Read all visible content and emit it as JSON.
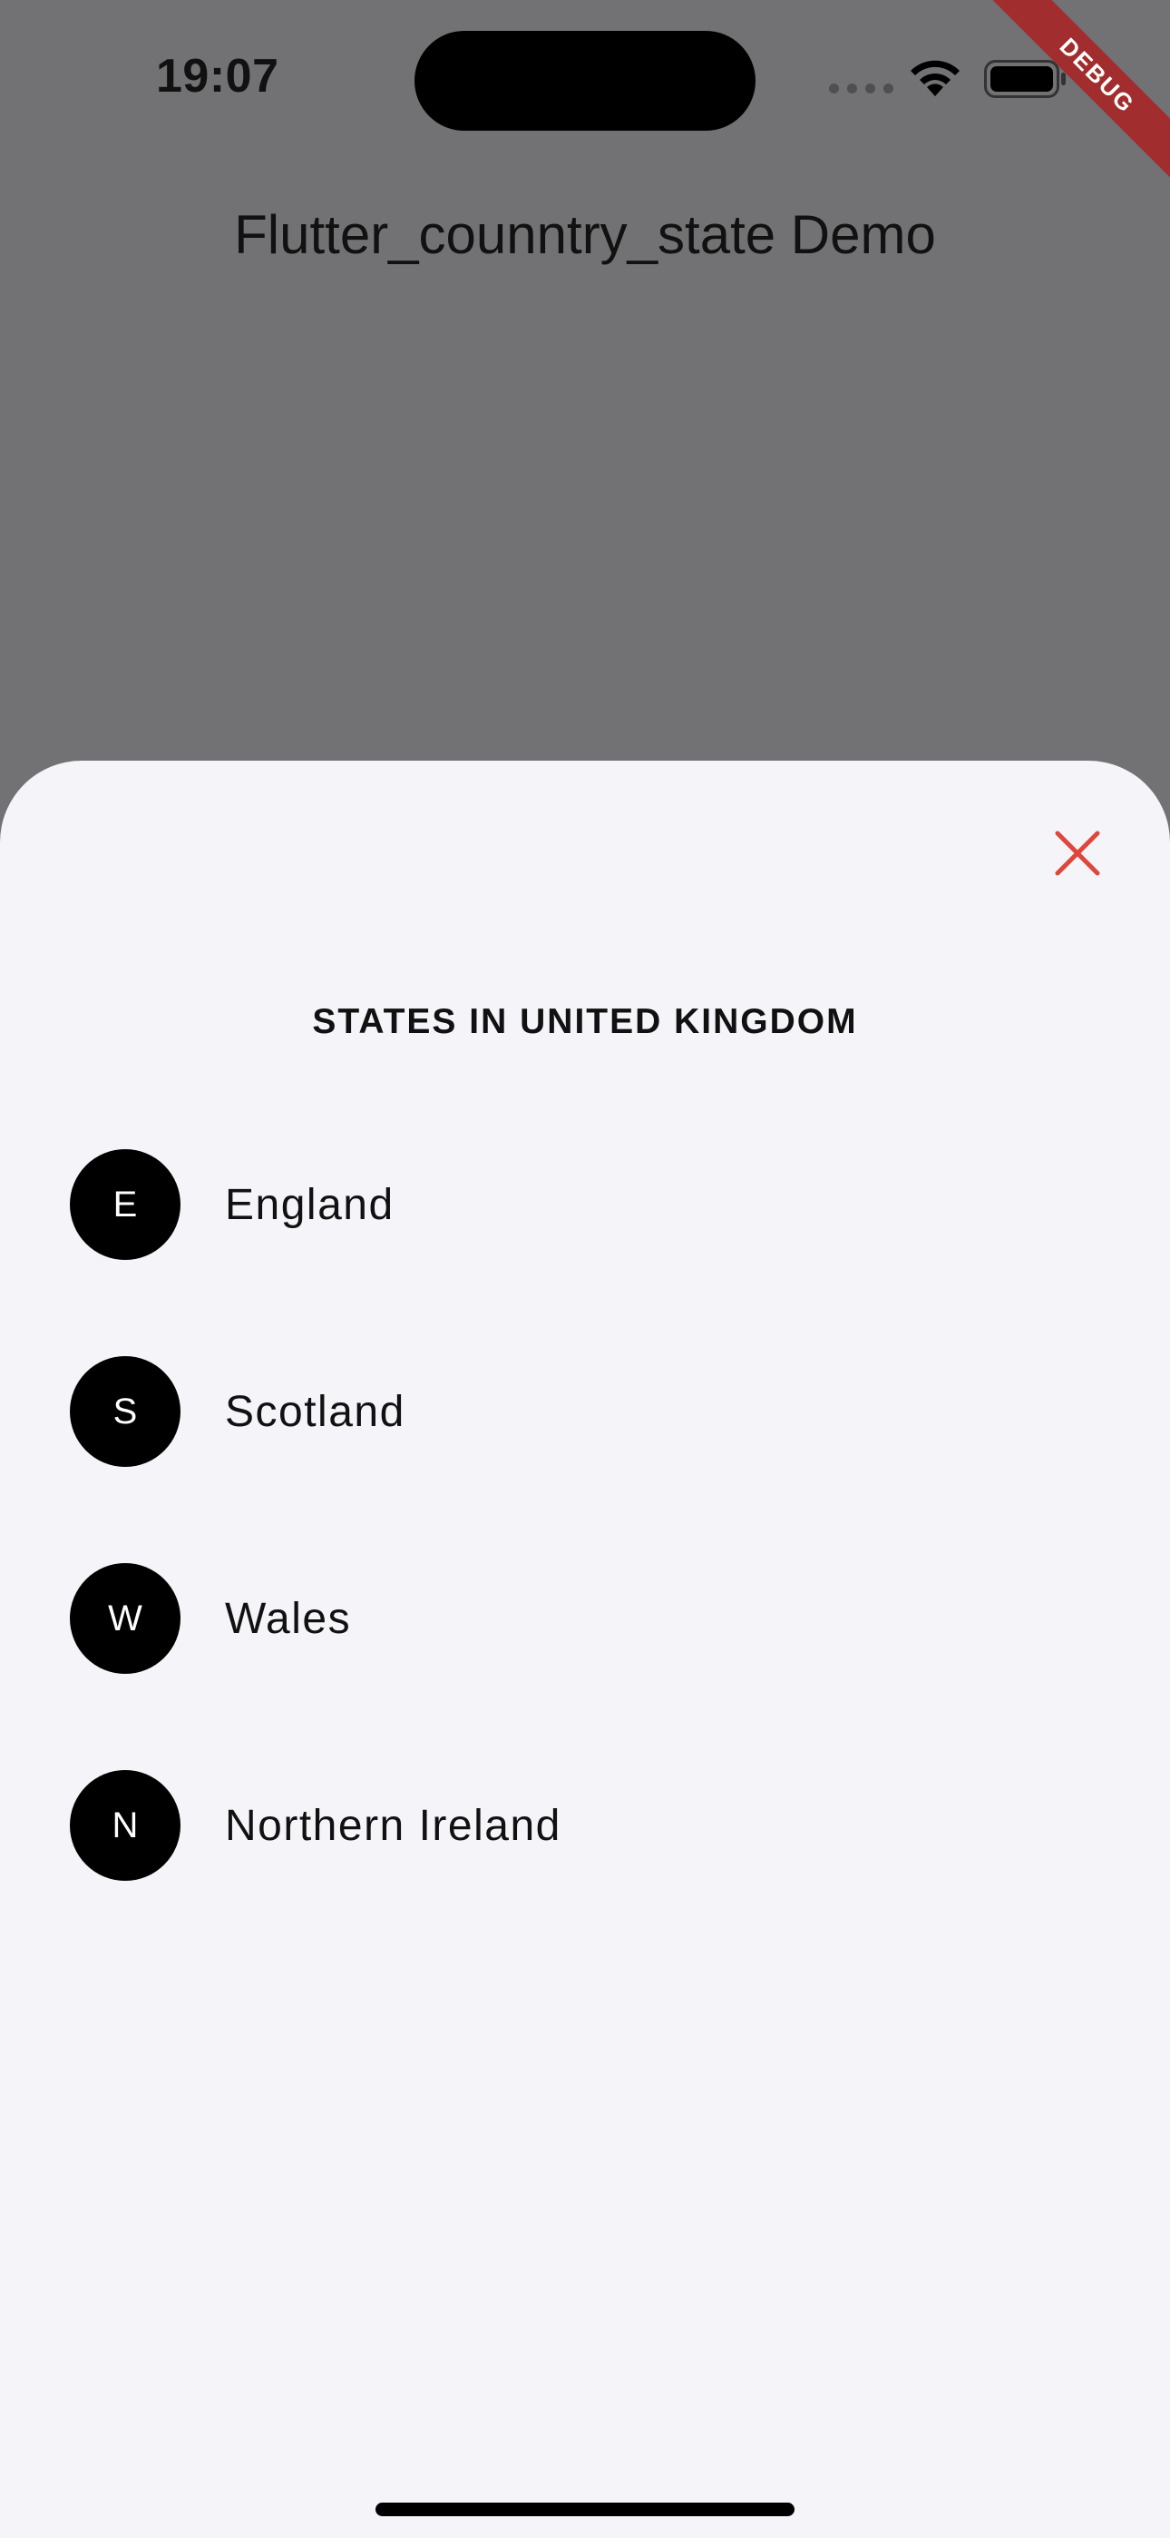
{
  "status_bar": {
    "time": "19:07",
    "icons": [
      "signal-icon",
      "wifi-icon",
      "battery-icon"
    ]
  },
  "debug_banner": {
    "label": "DEBUG"
  },
  "app_bar": {
    "title": "Flutter_counntry_state Demo"
  },
  "sheet": {
    "heading": "STATES IN UNITED KINGDOM",
    "close_icon": "close-icon",
    "accent_color": "#e0463b",
    "items": [
      {
        "initial": "E",
        "label": "England"
      },
      {
        "initial": "S",
        "label": "Scotland"
      },
      {
        "initial": "W",
        "label": "Wales"
      },
      {
        "initial": "N",
        "label": "Northern Ireland"
      }
    ]
  }
}
